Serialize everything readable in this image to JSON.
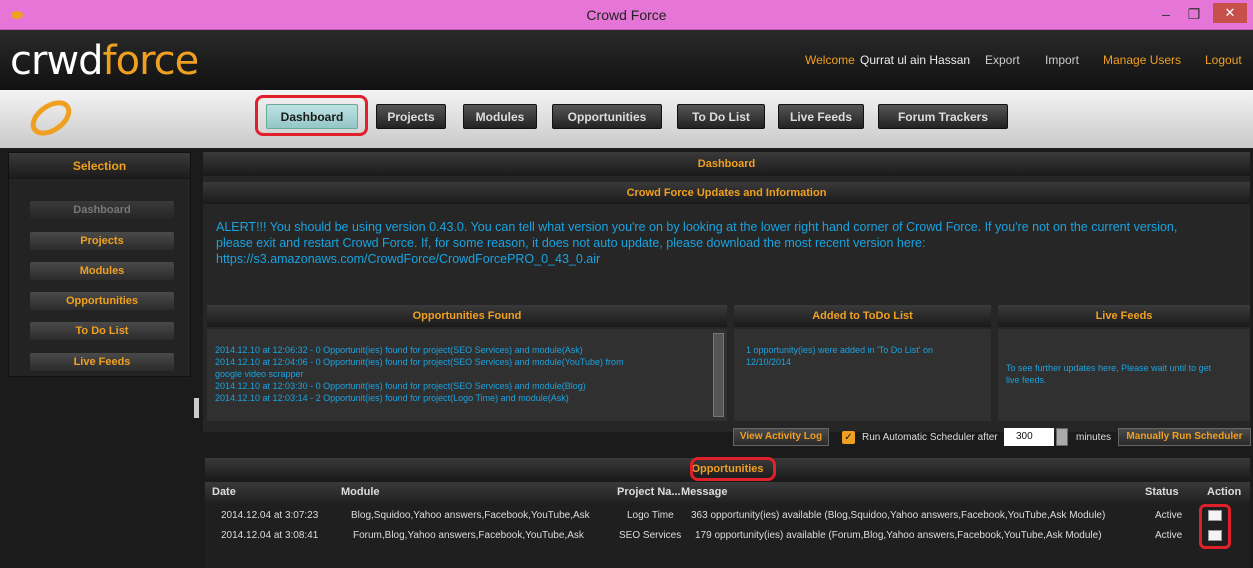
{
  "window": {
    "title": "Crowd Force",
    "minimize": "–",
    "restore": "❐",
    "close": "✕"
  },
  "brand": {
    "logo_pre": "cr",
    "logo_mid": "wd",
    "logo_force": "force"
  },
  "top_links": {
    "welcome": "Welcome",
    "user": "Qurrat ul ain Hassan",
    "export": "Export",
    "import": "Import",
    "manage_users": "Manage Users",
    "logout": "Logout"
  },
  "nav": [
    "Dashboard",
    "Projects",
    "Modules",
    "Opportunities",
    "To Do List",
    "Live Feeds",
    "Forum Trackers"
  ],
  "sidebar": {
    "title": "Selection",
    "items": [
      "Dashboard",
      "Projects",
      "Modules",
      "Opportunities",
      "To Do List",
      "Live Feeds"
    ]
  },
  "main": {
    "title": "Dashboard",
    "updates_title": "Crowd Force Updates and Information",
    "alert_lines": [
      "ALERT!!! You should be using version 0.43.0. You can tell what version you're on by looking at the lower right hand corner of Crowd Force. If you're not on the current version,",
      "please exit and restart Crowd Force. If, for some reason, it does not auto update, please download the most recent version here:",
      "https://s3.amazonaws.com/CrowdForce/CrowdForcePRO_0_43_0.air"
    ]
  },
  "opportunities_found": {
    "title": "Opportunities Found",
    "lines": [
      "2014.12.10 at 12:06:32 - 0 Opportunit(ies) found for project(SEO Services) and module(Ask)",
      "2014.12.10 at 12:04:06 - 0 Opportunit(ies) found for project(SEO Services) and module(YouTube) from",
      "google video scrapper",
      "2014.12.10 at 12:03:30 - 0 Opportunit(ies) found for project(SEO Services) and module(Blog)",
      "2014.12.10 at 12:03:14 - 2 Opportunit(ies) found for project(Logo Time) and module(Ask)"
    ]
  },
  "added_todo": {
    "title": "Added to ToDo List",
    "lines": [
      "1 opportunity(ies) were added in 'To Do List' on",
      "12/10/2014"
    ]
  },
  "live_feeds": {
    "title": "Live Feeds",
    "lines": [
      "To see further updates here, Please wait until to get",
      "live feeds."
    ]
  },
  "controls": {
    "view_log": "View Activity Log",
    "check_mark": "✓",
    "run_label": "Run Automatic Scheduler after",
    "minutes_value": "300",
    "minutes_label": "minutes",
    "manual_run": "Manually Run Scheduler"
  },
  "opportunities_table": {
    "title": "Opportunities",
    "headers": [
      "Date",
      "Module",
      "Project Na...",
      "Message",
      "Status",
      "Action"
    ],
    "rows": [
      {
        "date": "2014.12.04 at 3:07:23",
        "module": "Blog,Squidoo,Yahoo answers,Facebook,YouTube,Ask",
        "project": "Logo Time",
        "message": "363 opportunity(ies) available (Blog,Squidoo,Yahoo answers,Facebook,YouTube,Ask Module)",
        "status": "Active"
      },
      {
        "date": "2014.12.04 at 3:08:41",
        "module": "Forum,Blog,Yahoo answers,Facebook,YouTube,Ask",
        "project": "SEO Services",
        "message": "179 opportunity(ies) available (Forum,Blog,Yahoo answers,Facebook,YouTube,Ask Module)",
        "status": "Active"
      }
    ]
  },
  "colors": {
    "accent": "#f0a020",
    "link_blue": "#1aa3e0",
    "titlebar": "#e576d8",
    "highlight": "#e0202a"
  }
}
